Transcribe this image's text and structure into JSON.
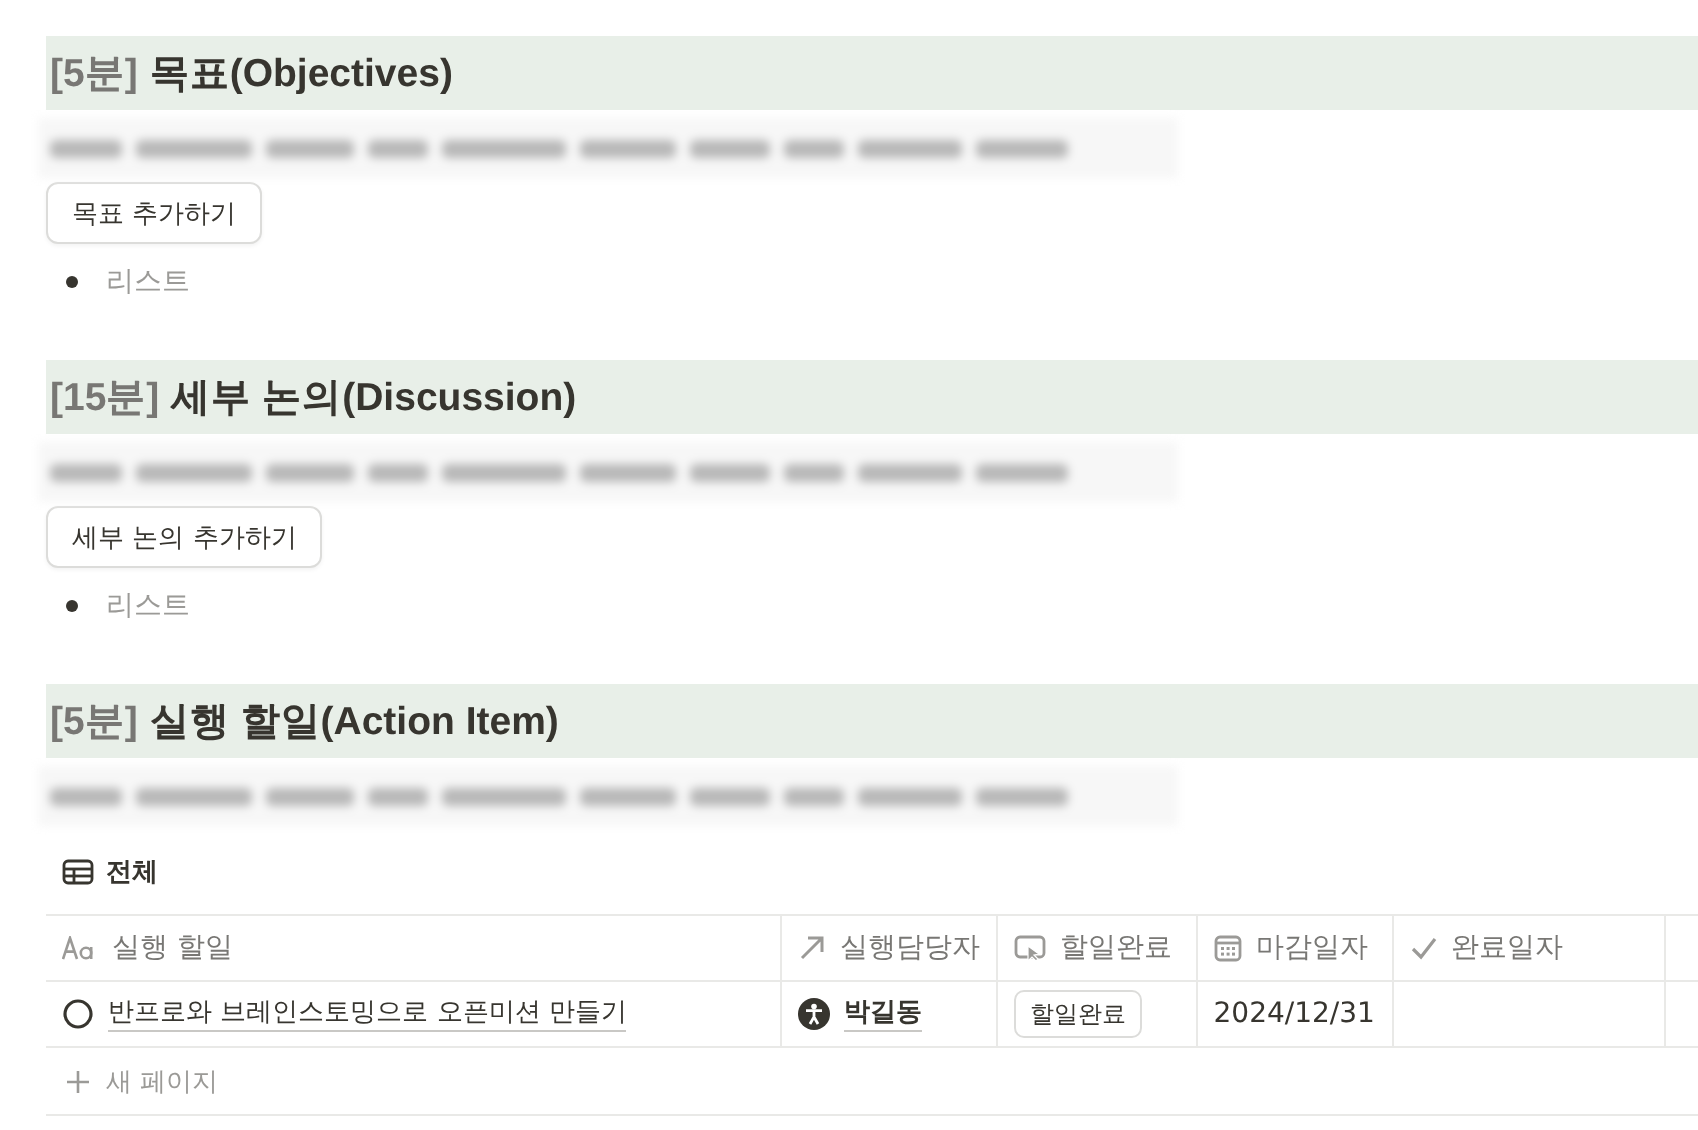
{
  "sections": [
    {
      "prefix": "[5분]",
      "title": "목표(Objectives)",
      "note_blurred": true,
      "button": "목표 추가하기",
      "list": [
        "리스트"
      ]
    },
    {
      "prefix": "[15분]",
      "title": "세부 논의(Discussion)",
      "note_blurred": true,
      "button": "세부 논의 추가하기",
      "list": [
        "리스트"
      ]
    },
    {
      "prefix": "[5분]",
      "title": "실행 할일(Action Item)",
      "note_blurred": true
    }
  ],
  "database": {
    "view": "전체",
    "columns": [
      {
        "label": "실행 할일",
        "kind": "title"
      },
      {
        "label": "실행담당자",
        "kind": "relation"
      },
      {
        "label": "할일완료",
        "kind": "button"
      },
      {
        "label": "마감일자",
        "kind": "date"
      },
      {
        "label": "완료일자",
        "kind": "check"
      }
    ],
    "rows": [
      {
        "cells": [
          "반프로와 브레인스토밍으로 오픈미션 만들기",
          "박길동",
          "할일완료",
          "2024/12/31",
          ""
        ]
      }
    ],
    "new_row": "새 페이지"
  }
}
